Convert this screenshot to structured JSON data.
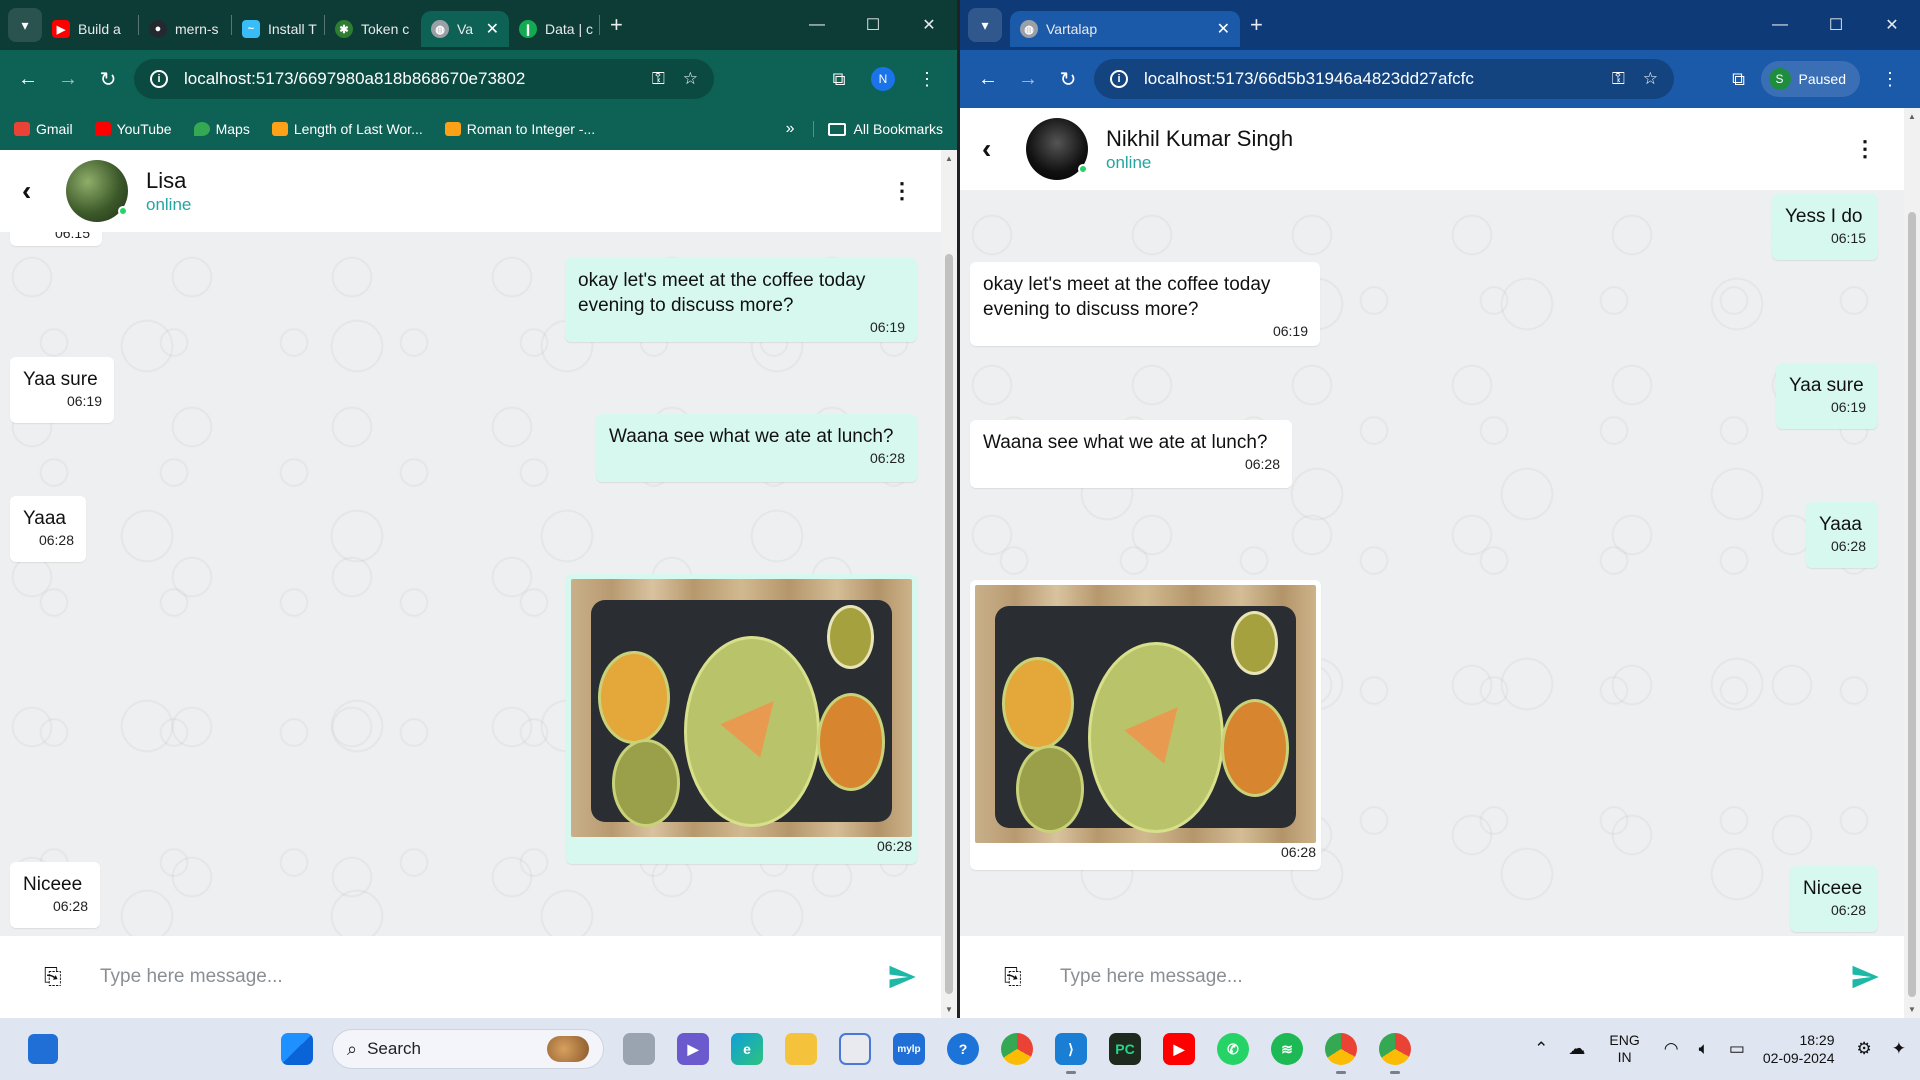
{
  "left_window": {
    "tabs": [
      {
        "title": "Build a",
        "icon": "youtube-icon",
        "color": "#ff0000"
      },
      {
        "title": "mern-s",
        "icon": "github-icon",
        "color": "#24292f"
      },
      {
        "title": "Install T",
        "icon": "tailwind-icon",
        "color": "#38bdf8"
      },
      {
        "title": "Token c",
        "icon": "jwt-icon",
        "color": "#2e7d32"
      },
      {
        "title": "Va",
        "icon": "globe-icon",
        "color": "#9aa0a6"
      },
      {
        "title": "Data | c",
        "icon": "mongodb-icon",
        "color": "#13aa52"
      }
    ],
    "url": "localhost:5173/6697980a818b868670e73802",
    "profile": "N",
    "bookmarks": [
      "Gmail",
      "YouTube",
      "Maps",
      "Length of Last Wor...",
      "Roman to Integer -..."
    ],
    "bookmarks_more": "»",
    "all_bookmarks": "All Bookmarks",
    "chat": {
      "name": "Lisa",
      "status": "online",
      "messages": [
        {
          "dir": "in",
          "text": "",
          "time": "06:15"
        },
        {
          "dir": "out",
          "text": "okay let's meet at the coffee today evening to discuss more?",
          "time": "06:19"
        },
        {
          "dir": "in",
          "text": "Yaa sure",
          "time": "06:19"
        },
        {
          "dir": "out",
          "text": "Waana see what we ate at lunch?",
          "time": "06:28"
        },
        {
          "dir": "in",
          "text": "Yaaa",
          "time": "06:28"
        },
        {
          "dir": "out",
          "image": "food-tray-photo",
          "time": "06:28"
        },
        {
          "dir": "in",
          "text": "Niceee",
          "time": "06:28"
        }
      ],
      "input_placeholder": "Type here message..."
    }
  },
  "right_window": {
    "tab_title": "Vartalap",
    "url": "localhost:5173/66d5b31946a4823dd27afcfc",
    "profile_letter": "S",
    "profile_status": "Paused",
    "chat": {
      "name": "Nikhil Kumar Singh",
      "status": "online",
      "messages": [
        {
          "dir": "out",
          "text": "Yess I do",
          "time": "06:15"
        },
        {
          "dir": "in",
          "text": "okay let's meet at the coffee today evening to discuss more?",
          "time": "06:19"
        },
        {
          "dir": "out",
          "text": "Yaa sure",
          "time": "06:19"
        },
        {
          "dir": "in",
          "text": "Waana see what we ate at lunch?",
          "time": "06:28"
        },
        {
          "dir": "out",
          "text": "Yaaa",
          "time": "06:28"
        },
        {
          "dir": "in",
          "image": "food-tray-photo",
          "time": "06:28"
        },
        {
          "dir": "out",
          "text": "Niceee",
          "time": "06:28"
        }
      ],
      "input_placeholder": "Type here message..."
    }
  },
  "taskbar": {
    "search_label": "Search",
    "apps": [
      "task-view",
      "meet",
      "edge",
      "file-explorer",
      "store",
      "mylp",
      "help",
      "chrome",
      "vscode",
      "pycharm",
      "youtube",
      "whatsapp",
      "spotify",
      "chrome-profile-n",
      "chrome-profile-s"
    ],
    "language": "ENG",
    "region": "IN",
    "time": "18:29",
    "date": "02-09-2024"
  },
  "colors": {
    "incoming_bubble": "#ffffff",
    "outgoing_bubble": "#d6f8ee",
    "online_status": "#25a5a0",
    "send_button": "#1fb8a6"
  }
}
